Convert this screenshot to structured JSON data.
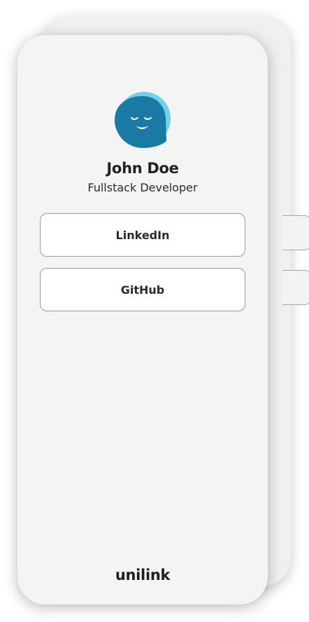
{
  "profile": {
    "name": "John Doe",
    "role": "Fullstack Developer",
    "avatar_icon": "smiling-face-avatar-icon"
  },
  "links": [
    {
      "label": "LinkedIn"
    },
    {
      "label": "GitHub"
    }
  ],
  "footer": {
    "brand": "unilink"
  },
  "colors": {
    "card_background": "#f4f4f4",
    "avatar_primary": "#1b7aa3",
    "avatar_accent": "#6dd3e8",
    "text_dark": "#222222",
    "button_border": "#9a9a9a"
  }
}
